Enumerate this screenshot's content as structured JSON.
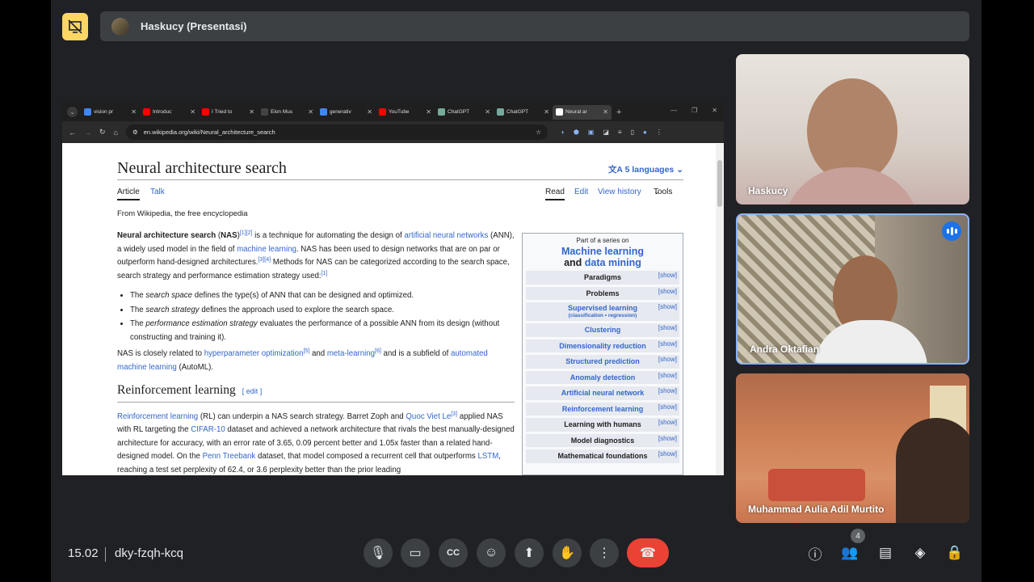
{
  "presentation": {
    "title": "Haskucy (Presentasi)"
  },
  "browser": {
    "tabs": [
      {
        "label": "vision pr",
        "favicon_color": "#4285f4"
      },
      {
        "label": "Introduc",
        "favicon_color": "#ff0000"
      },
      {
        "label": "I Tried to",
        "favicon_color": "#ff0000"
      },
      {
        "label": "Elon Mus",
        "favicon_color": "#444444"
      },
      {
        "label": "generativ",
        "favicon_color": "#4285f4"
      },
      {
        "label": "YouTube",
        "favicon_color": "#ff0000"
      },
      {
        "label": "ChatGPT",
        "favicon_color": "#74aa9c"
      },
      {
        "label": "ChatGPT",
        "favicon_color": "#74aa9c"
      },
      {
        "label": "Neural ar",
        "favicon_color": "#ffffff",
        "active": true
      }
    ],
    "url": "en.wikipedia.org/wiki/Neural_architecture_search"
  },
  "article": {
    "title": "Neural architecture search",
    "languages": "5 languages",
    "tab_article": "Article",
    "tab_talk": "Talk",
    "tab_read": "Read",
    "tab_edit": "Edit",
    "tab_history": "View history",
    "tab_tools": "Tools",
    "tagline": "From Wikipedia, the free encyclopedia",
    "p1": {
      "term": "Neural architecture search",
      "abbr": "NAS",
      "refs_a": "[1][2]",
      "t1": " is a technique for automating the design of ",
      "link1": "artificial neural networks",
      "t2": " (ANN), a widely used model in the field of ",
      "link2": "machine learning",
      "t3": ". NAS has been used to design networks that are on par or outperform hand-designed architectures.",
      "refs_b": "[3][4]",
      "t4": " Methods for NAS can be categorized according to the search space, search strategy and performance estimation strategy used:",
      "refs_c": "[1]"
    },
    "bullets": [
      {
        "pre": "The ",
        "em": "search space",
        "post": " defines the type(s) of ANN that can be designed and optimized."
      },
      {
        "pre": "The ",
        "em": "search strategy",
        "post": " defines the approach used to explore the search space."
      },
      {
        "pre": "The ",
        "em": "performance estimation strategy",
        "post": " evaluates the performance of a possible ANN from its design (without constructing and training it)."
      }
    ],
    "p2": {
      "t1": "NAS is closely related to ",
      "link1": "hyperparameter optimization",
      "ref1": "[5]",
      "t2": " and ",
      "link2": "meta-learning",
      "ref2": "[6]",
      "t3": " and is a subfield of ",
      "link3": "automated machine learning",
      "t4": " (AutoML)."
    },
    "section_title": "Reinforcement learning",
    "section_edit": "[ edit ]",
    "p3": {
      "link1": "Reinforcement learning",
      "t1": " (RL) can underpin a NAS search strategy. Barret Zoph and ",
      "link2": "Quoc Viet Le",
      "ref1": "[3]",
      "t2": " applied NAS with RL targeting the ",
      "link3": "CIFAR-10",
      "t3": " dataset and achieved a network architecture that rivals the best manually-designed architecture for accuracy, with an error rate of 3.65, 0.09 percent better and 1.05x faster than a related hand-designed model. On the ",
      "link4": "Penn Treebank",
      "t4": " dataset, that model composed a recurrent cell that outperforms ",
      "link5": "LSTM",
      "t5": ", reaching a test set perplexity of 62.4, or 3.6 perplexity better than the prior leading"
    }
  },
  "infobox": {
    "pre": "Part of a series on",
    "title1": "Machine learning",
    "title2_and": "and",
    "title2_link": "data mining",
    "show": "[show]",
    "rows": [
      {
        "label": "Paradigms",
        "blue": false
      },
      {
        "label": "Problems",
        "blue": false
      },
      {
        "label": "Supervised learning",
        "sub": "(classification • regression)",
        "blue": true
      },
      {
        "label": "Clustering",
        "blue": true
      },
      {
        "label": "Dimensionality reduction",
        "blue": true
      },
      {
        "label": "Structured prediction",
        "blue": true
      },
      {
        "label": "Anomaly detection",
        "blue": true
      },
      {
        "label": "Artificial neural network",
        "blue": true
      },
      {
        "label": "Reinforcement learning",
        "blue": true
      },
      {
        "label": "Learning with humans",
        "blue": false
      },
      {
        "label": "Model diagnostics",
        "blue": false
      },
      {
        "label": "Mathematical foundations",
        "blue": false
      }
    ]
  },
  "participants": [
    {
      "name": "Haskucy"
    },
    {
      "name": "Andra Oktafian",
      "speaking": true
    },
    {
      "name": "Muhammad Aulia Adil Murtito"
    }
  ],
  "meeting": {
    "time": "15.02",
    "code": "dky-fzqh-kcq",
    "participant_count": "4"
  },
  "colors": {
    "accent": "#8ab4f8",
    "end_call": "#ea4335",
    "pin": "#fdd663"
  }
}
